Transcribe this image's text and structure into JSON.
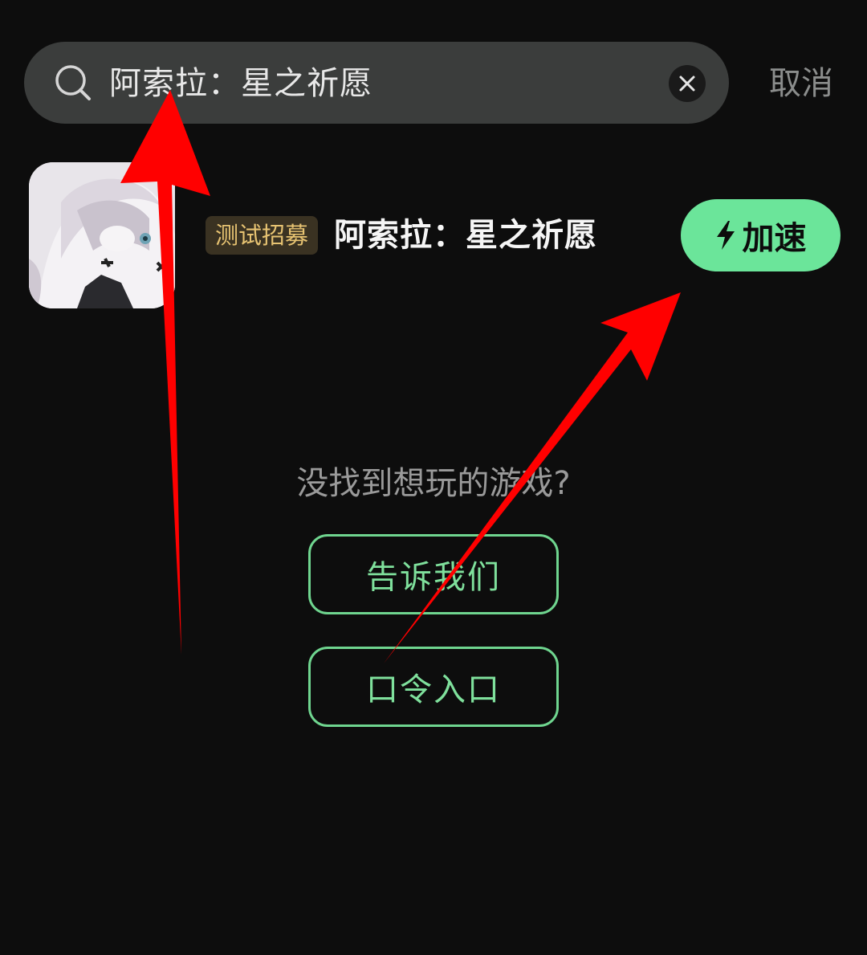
{
  "search": {
    "query": "阿索拉：星之祈愿",
    "cancel_label": "取消"
  },
  "result": {
    "badge": "测试招募",
    "title": "阿索拉：星之祈愿",
    "accelerate_label": "加速"
  },
  "empty": {
    "prompt": "没找到想玩的游戏?",
    "tell_us_label": "告诉我们",
    "code_entry_label": "口令入口"
  },
  "colors": {
    "accent_green": "#6be59a",
    "badge_text": "#e7c372",
    "annotation_arrow": "#ff0000"
  },
  "icons": {
    "search": "search-icon",
    "clear": "close-icon",
    "accelerate": "lightning-icon"
  }
}
